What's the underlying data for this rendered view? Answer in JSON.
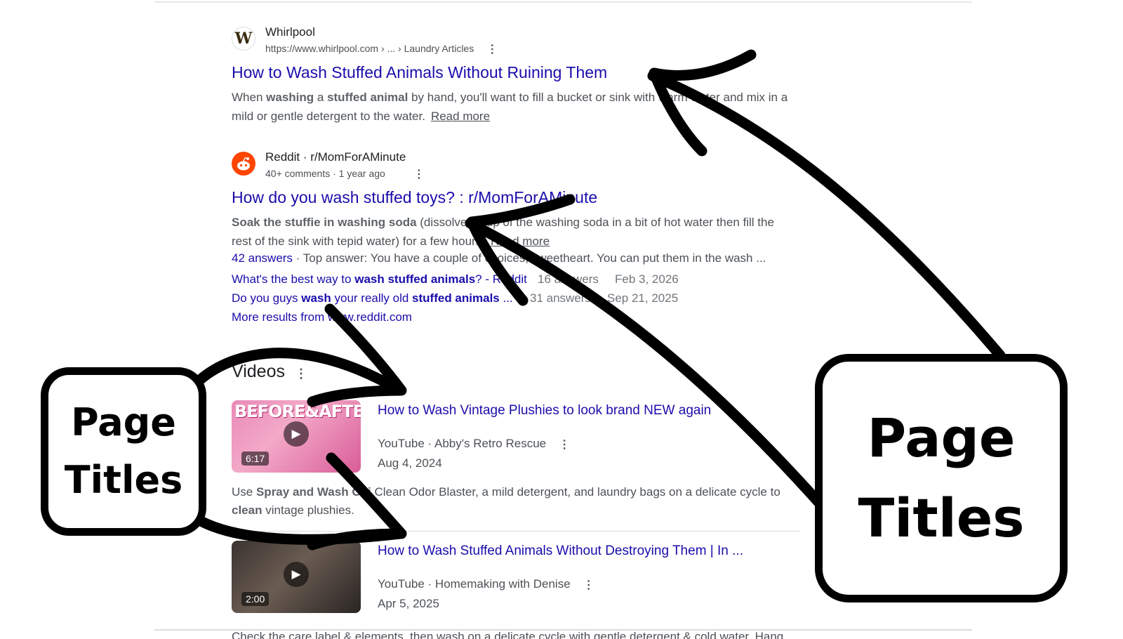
{
  "results": [
    {
      "site": "Whirlpool",
      "url": "https://www.whirlpool.com › ... › Laundry Articles",
      "title": "How to Wash Stuffed Animals Without Ruining Them",
      "snippet_l1_a": "When ",
      "snippet_l1_b": "washing",
      "snippet_l1_c": " a ",
      "snippet_l1_d": "stuffed animal",
      "snippet_l1_e": " by hand, you'll want to fill a bucket or sink with warm water and mix in a",
      "snippet_l2": "mild or gentle detergent to the water.",
      "read_more": "Read more",
      "favicon_letter": "W"
    },
    {
      "site": "Reddit · r/MomForAMinute",
      "meta": "40+ comments · 1 year ago",
      "title": "How do you wash stuffed toys? : r/MomForAMinute",
      "snippet_bold": "Soak the stuffie in washing soda",
      "snippet_l1": " (dissolve 1 cup of the washing soda in a bit of hot water then fill the",
      "snippet_l2": "rest of the sink with tepid water) for a few hours.",
      "read_more": "Read more",
      "answers_count": "42 answers",
      "answers_text": " · Top answer: You have a couple of choices, sweetheart. You can put them in the wash ...",
      "sub_results": [
        {
          "q_a": "What's the best way to ",
          "q_b": "wash stuffed animals",
          "q_c": "? - Reddit",
          "answers": "16 answers",
          "date": "Feb 3, 2026"
        },
        {
          "q_a": "Do you guys ",
          "q_b": "wash",
          "q_c": " your really old ",
          "q_d": "stuffed animals",
          "q_e": " ...",
          "answers": "31 answers",
          "date": "Sep 21, 2025"
        }
      ],
      "more_results": "More results from www.reddit.com"
    }
  ],
  "videos": {
    "heading": "Videos",
    "items": [
      {
        "title": "How to Wash Vintage Plushies to look brand NEW again",
        "source": "YouTube · Abby's Retro Rescue",
        "date": "Aug 4, 2024",
        "duration": "6:17",
        "thumb_text": "BEFORE&AFTER",
        "snippet_a": "Use ",
        "snippet_b": "Spray and Wash Oxi",
        "snippet_c": " Clean Odor Blaster, a mild detergent, and laundry bags on a delicate cycle to",
        "snippet_d": "clean",
        "snippet_e": " vintage plushies."
      },
      {
        "title": "How to Wash Stuffed Animals Without Destroying Them | In ...",
        "source": "YouTube · Homemaking with Denise",
        "date": "Apr 5, 2025",
        "duration": "2:00",
        "snippet": "Check the care label & elements, then wash on a delicate cycle with gentle detergent & cold water. Hang"
      }
    ]
  },
  "callouts": {
    "left_line1": "Page",
    "left_line2": "Titles",
    "right_line1": "Page",
    "right_line2": "Titles"
  },
  "icons": {
    "kebab": "⋮",
    "play": "▶"
  },
  "colors": {
    "link": "#1a0dab",
    "reddit": "#ff4500",
    "annotation": "#000000"
  }
}
